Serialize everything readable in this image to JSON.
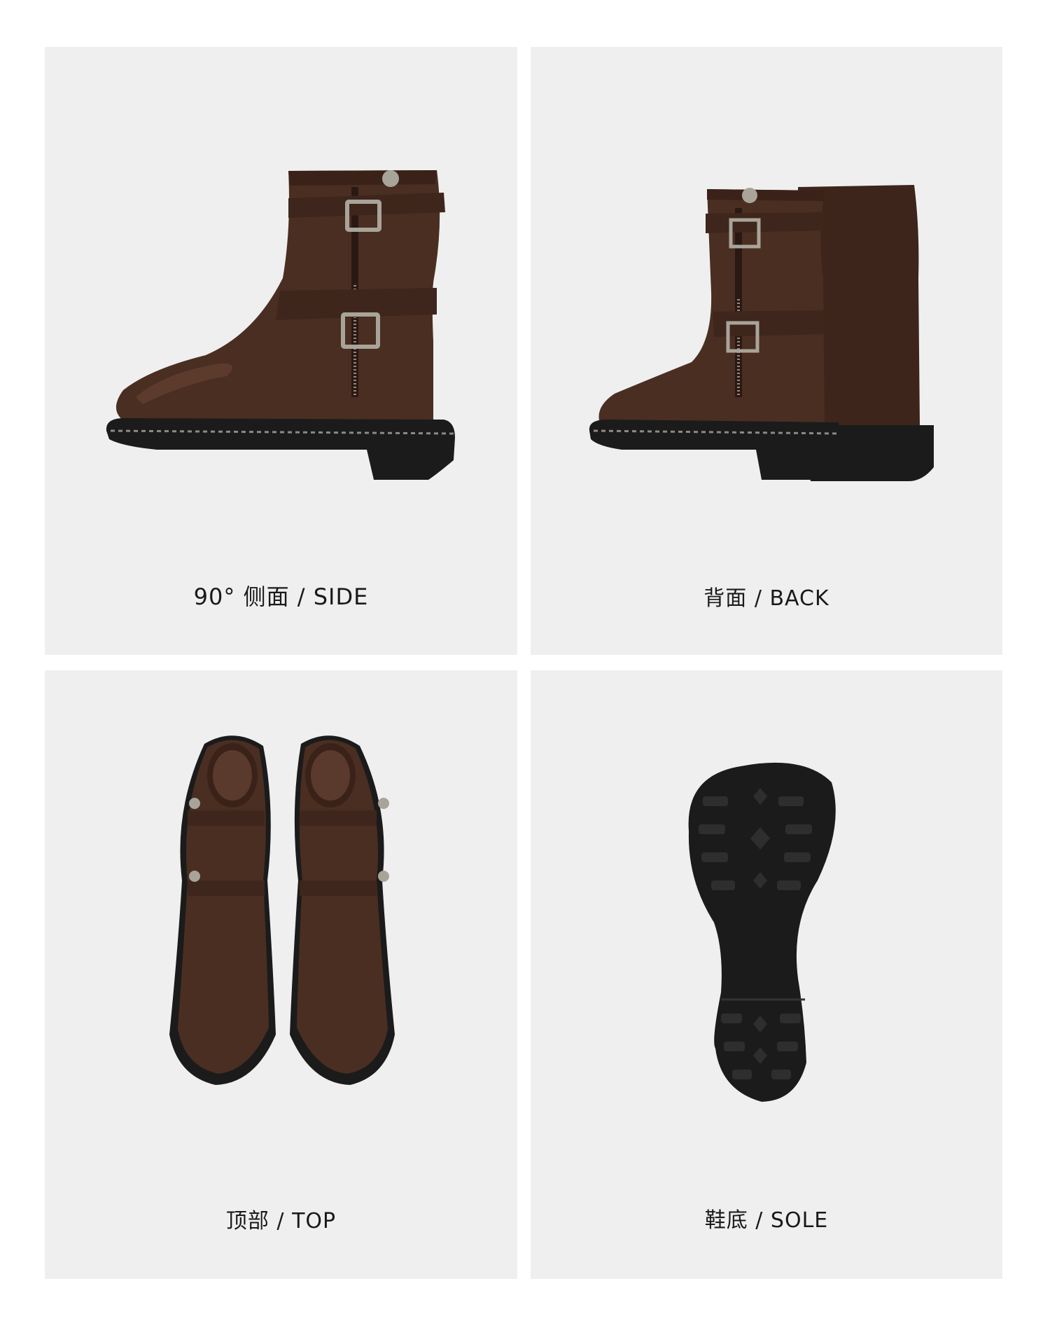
{
  "panels": [
    {
      "id": "side",
      "caption": "90°  侧面  /  SIDE",
      "image_label": "brown leather engineer boot, side view"
    },
    {
      "id": "back",
      "caption": "背面  /  BACK",
      "image_label": "pair of brown leather boots, back view"
    },
    {
      "id": "top",
      "caption": "顶部  /  TOP",
      "image_label": "pair of brown leather boots, top view"
    },
    {
      "id": "sole",
      "caption": "鞋底 / SOLE",
      "image_label": "black lug rubber outsole"
    }
  ],
  "colors": {
    "panel_bg": "#efefef",
    "leather": "#4a2e22",
    "leather_light": "#6b4433",
    "sole": "#1b1b1b",
    "metal": "#a9a49a"
  }
}
